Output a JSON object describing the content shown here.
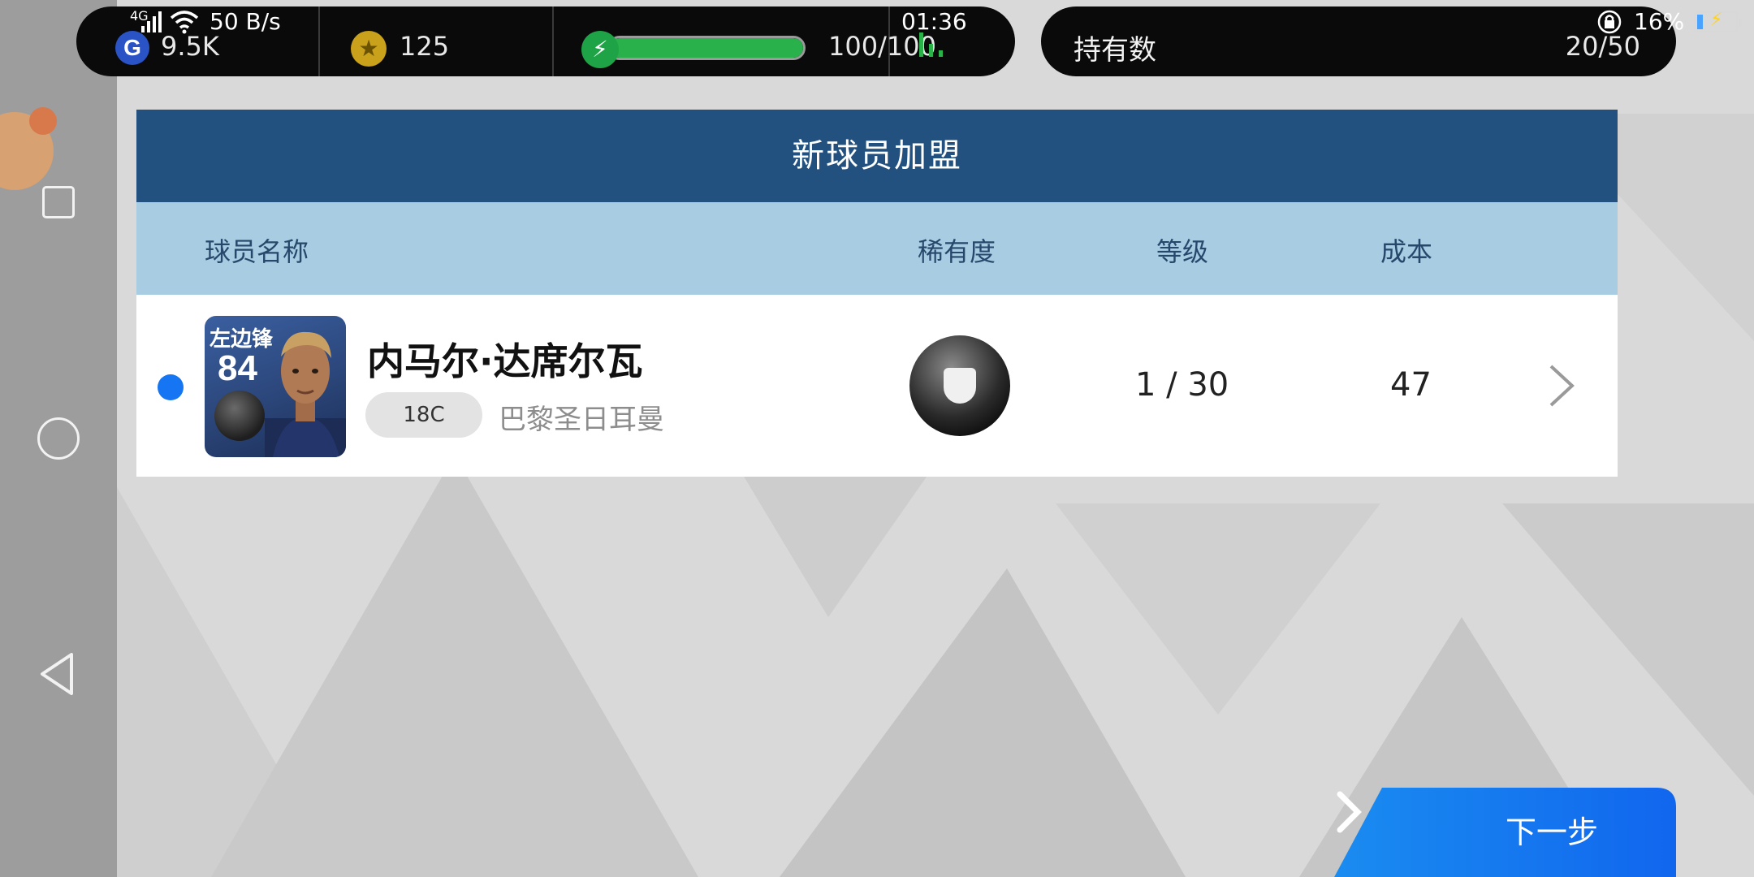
{
  "status_bar": {
    "network": "4G",
    "speed": "50 B/s",
    "time": "01:36",
    "battery_percent": "16%",
    "battery_level": 0.16
  },
  "currencies": {
    "gp_value": "9.5K",
    "coins_value": "125",
    "energy_value": "100/100",
    "energy_fraction": 1.0
  },
  "holdings": {
    "label": "持有数",
    "value": "20/50"
  },
  "panel": {
    "title": "新球员加盟",
    "columns": {
      "name": "球员名称",
      "rarity": "稀有度",
      "level": "等级",
      "cost": "成本"
    }
  },
  "player": {
    "position": "左边锋",
    "rating": "84",
    "name": "内马尔·达席尔瓦",
    "tag": "18C",
    "club": "巴黎圣日耳曼",
    "level": "1 / 30",
    "cost": "47"
  },
  "next_button": {
    "label": "下一步"
  },
  "colors": {
    "panel_title_bg": "#22517f",
    "header_bg": "#a8cde3",
    "accent_blue": "#1675f2",
    "energy_green": "#29b24b"
  }
}
